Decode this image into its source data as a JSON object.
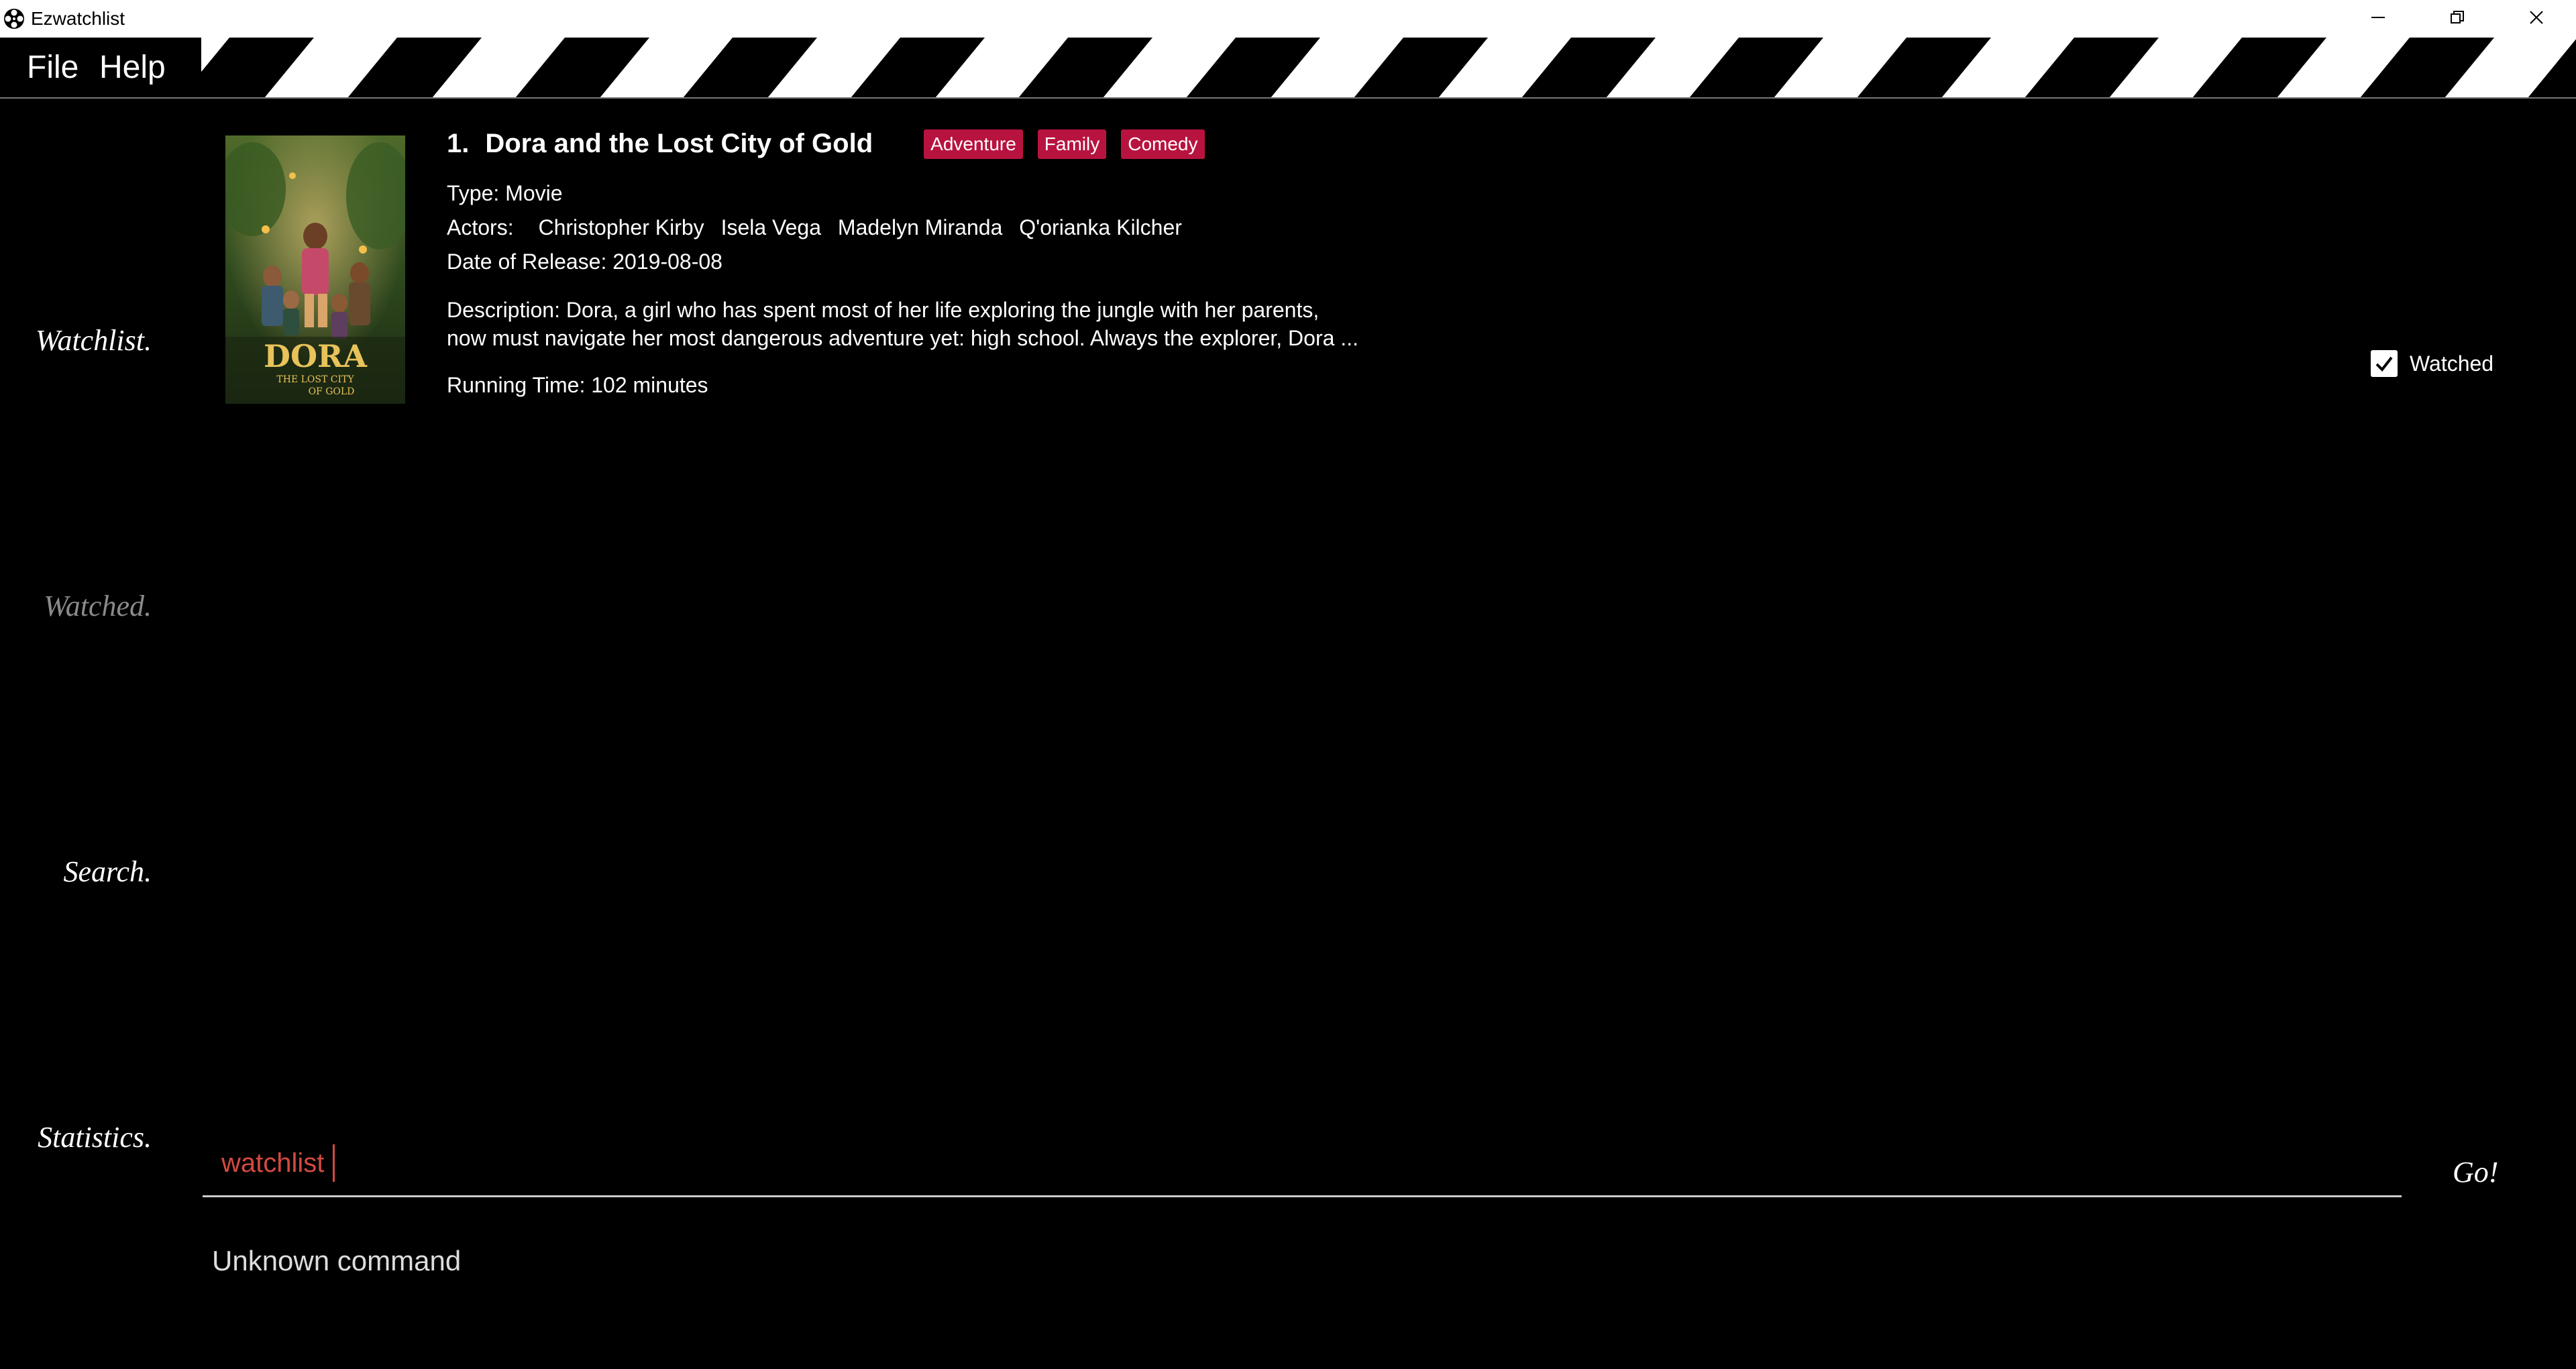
{
  "window": {
    "title": "Ezwatchlist",
    "app_icon": "film-reel-icon",
    "controls": [
      "minimize-icon",
      "restore-icon",
      "close-icon"
    ]
  },
  "menu": {
    "file": "File",
    "help": "Help"
  },
  "sidebar": {
    "items": [
      {
        "label": "Watchlist.",
        "active": true
      },
      {
        "label": "Watched.",
        "active": false
      },
      {
        "label": "Search.",
        "active": true
      },
      {
        "label": "Statistics.",
        "active": true
      }
    ]
  },
  "movie": {
    "index": "1.",
    "title": "Dora and the Lost City of Gold",
    "tags": [
      "Adventure",
      "Family",
      "Comedy"
    ],
    "type_line": "Type: Movie",
    "actors_label": "Actors:",
    "actors": [
      "Christopher Kirby",
      "Isela Vega",
      "Madelyn Miranda",
      "Q'orianka Kilcher"
    ],
    "release_line": "Date of Release: 2019-08-08",
    "description_line1": "Description: Dora, a girl who has spent most of her life exploring the jungle with her parents,",
    "description_line2": "now must navigate her most dangerous adventure yet: high school. Always the explorer, Dora ...",
    "runtime_line": "Running Time: 102 minutes",
    "poster": {
      "title": "DORA",
      "subtitle_a": "THE LOST CITY",
      "subtitle_b": "OF GOLD"
    },
    "watched_label": "Watched",
    "watched_checked": true
  },
  "command": {
    "value": "watchlist",
    "go_label": "Go!",
    "result": "Unknown command"
  },
  "colors": {
    "accent": "#b8133f",
    "command_text": "#d34a40"
  }
}
